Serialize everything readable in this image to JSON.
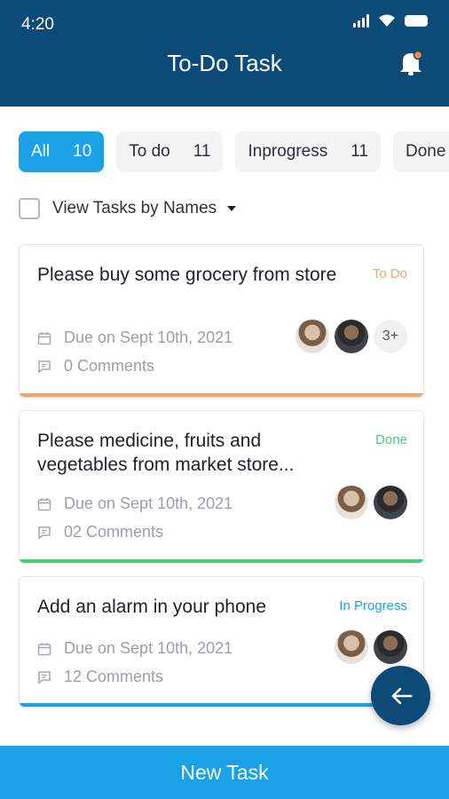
{
  "status_bar": {
    "time": "4:20"
  },
  "header": {
    "title": "To-Do Task",
    "icon": "bell-icon"
  },
  "filters": [
    {
      "label": "All",
      "count": "10",
      "active": true
    },
    {
      "label": "To do",
      "count": "11"
    },
    {
      "label": "Inprogress",
      "count": "11"
    },
    {
      "label": "Done",
      "count": ""
    }
  ],
  "view_toggle": {
    "label": "View Tasks by Names",
    "checked": false
  },
  "tasks": [
    {
      "title": "Please buy some grocery from store",
      "status": "To Do",
      "status_color": "#f7a468",
      "due": "Due on Sept 10th, 2021",
      "comments": "0 Comments",
      "extra_assignees": "3+"
    },
    {
      "title": "Please medicine, fruits and vegetables from market store...",
      "status": "Done",
      "status_color": "#4cc97a",
      "due": "Due on Sept 10th, 2021",
      "comments": "02 Comments"
    },
    {
      "title": "Add an alarm in your phone",
      "status": "In Progress",
      "status_color": "#1ba1e6",
      "due": "Due on Sept 10th, 2021",
      "comments": "12 Comments"
    }
  ],
  "fab": {
    "icon": "arrow-left-icon"
  },
  "footer": {
    "new_task_label": "New Task"
  },
  "colors": {
    "header": "#0c4a78",
    "accent": "#1ba1e6"
  }
}
